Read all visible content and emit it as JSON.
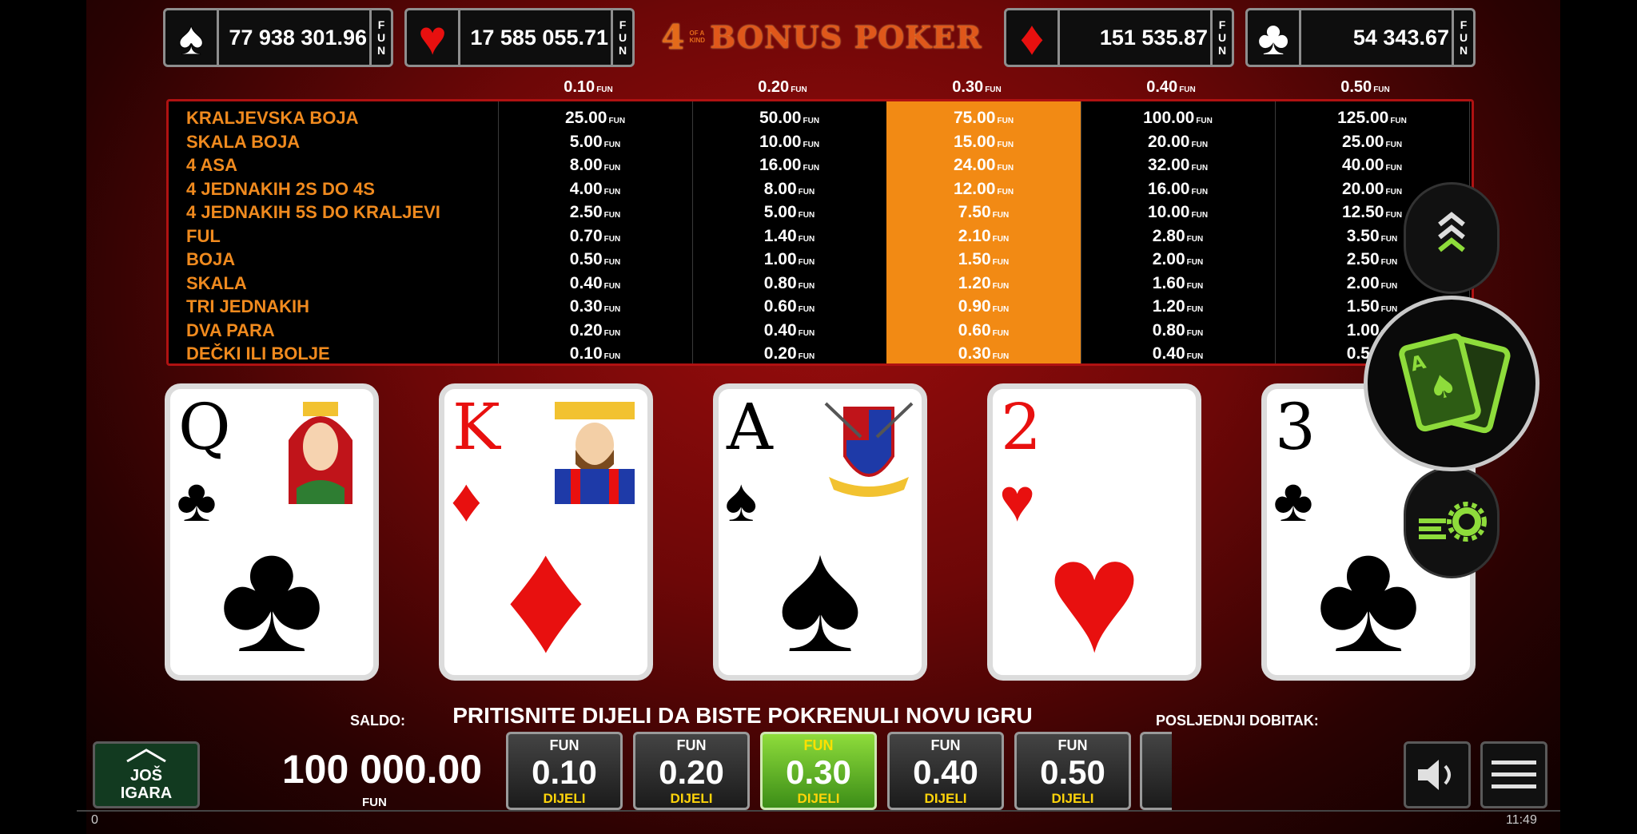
{
  "jackpots": [
    {
      "suit": "spade-icon",
      "symbol": "♠",
      "color": "#ffffff",
      "value": "77 938 301.96",
      "unit": "FUN"
    },
    {
      "suit": "heart-icon",
      "symbol": "♥",
      "color": "#e8100f",
      "value": "17 585 055.71",
      "unit": "FUN"
    },
    {
      "suit": "diamond-icon",
      "symbol": "♦",
      "color": "#e8100f",
      "value": "151 535.87",
      "unit": "FUN"
    },
    {
      "suit": "club-icon",
      "symbol": "♣",
      "color": "#ffffff",
      "value": "54 343.67",
      "unit": "FUN"
    }
  ],
  "title": {
    "four": "4",
    "of": "OF A",
    "kind": "KIND",
    "name": "BONUS POKER"
  },
  "bet_headers": [
    "0.10",
    "0.20",
    "0.30",
    "0.40",
    "0.50"
  ],
  "unit": "FUN",
  "paytable": {
    "selected_column": 2,
    "hands": [
      "KRALJEVSKA BOJA",
      "SKALA BOJA",
      "4 ASA",
      "4 JEDNAKIH 2S DO 4S",
      "4 JEDNAKIH 5S DO KRALJEVI",
      "FUL",
      "BOJA",
      "SKALA",
      "TRI JEDNAKIH",
      "DVA PARA",
      "DEČKI ILI BOLJE"
    ],
    "columns": [
      [
        "25.00",
        "5.00",
        "8.00",
        "4.00",
        "2.50",
        "0.70",
        "0.50",
        "0.40",
        "0.30",
        "0.20",
        "0.10"
      ],
      [
        "50.00",
        "10.00",
        "16.00",
        "8.00",
        "5.00",
        "1.40",
        "1.00",
        "0.80",
        "0.60",
        "0.40",
        "0.20"
      ],
      [
        "75.00",
        "15.00",
        "24.00",
        "12.00",
        "7.50",
        "2.10",
        "1.50",
        "1.20",
        "0.90",
        "0.60",
        "0.30"
      ],
      [
        "100.00",
        "20.00",
        "32.00",
        "16.00",
        "10.00",
        "2.80",
        "2.00",
        "1.60",
        "1.20",
        "0.80",
        "0.40"
      ],
      [
        "125.00",
        "25.00",
        "40.00",
        "20.00",
        "12.50",
        "3.50",
        "2.50",
        "2.00",
        "1.50",
        "1.00",
        "0.50"
      ]
    ]
  },
  "cards": [
    {
      "rank": "Q",
      "suit": "♣",
      "color": "blk",
      "face": "queen"
    },
    {
      "rank": "K",
      "suit": "♦",
      "color": "red",
      "face": "king"
    },
    {
      "rank": "A",
      "suit": "♠",
      "color": "blk",
      "face": "crest"
    },
    {
      "rank": "2",
      "suit": "♥",
      "color": "red",
      "face": ""
    },
    {
      "rank": "3",
      "suit": "♣",
      "color": "blk",
      "face": ""
    }
  ],
  "message": "PRITISNITE DIJELI DA BISTE POKRENULI NOVU IGRU",
  "balance_label": "SALDO:",
  "balance": "100 000.00",
  "balance_unit": "FUN",
  "last_win_label": "POSLJEDNJI DOBITAK:",
  "more_games": {
    "line1": "JOŠ",
    "line2": "IGARA"
  },
  "bet_buttons": [
    {
      "top": "FUN",
      "value": "0.10",
      "action": "DIJELI",
      "selected": false
    },
    {
      "top": "FUN",
      "value": "0.20",
      "action": "DIJELI",
      "selected": false
    },
    {
      "top": "FUN",
      "value": "0.30",
      "action": "DIJELI",
      "selected": true
    },
    {
      "top": "FUN",
      "value": "0.40",
      "action": "DIJELI",
      "selected": false
    },
    {
      "top": "FUN",
      "value": "0.50",
      "action": "DIJELI",
      "selected": false
    }
  ],
  "status": {
    "left": "0",
    "right": "11:49"
  },
  "colors": {
    "accent_green": "#8edc3b",
    "paytable_highlight": "#f28a14",
    "hand_name": "#f08a1e",
    "frame_red": "#b01212"
  }
}
